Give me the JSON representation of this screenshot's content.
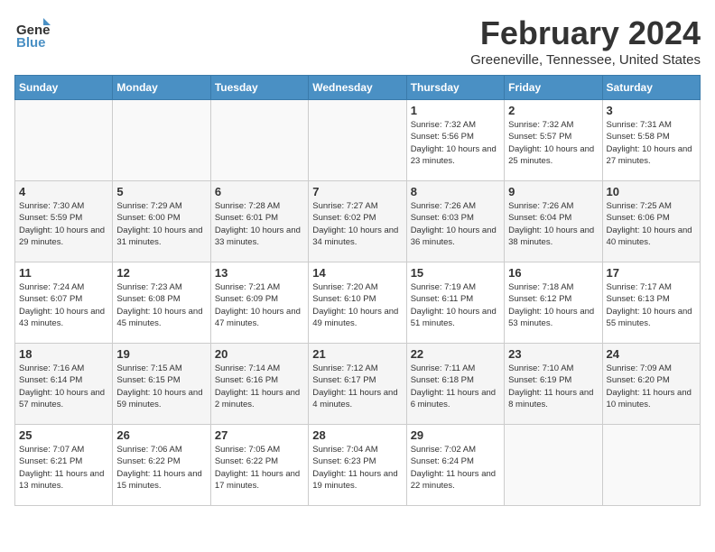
{
  "header": {
    "logo_line1": "General",
    "logo_line2": "Blue",
    "title": "February 2024",
    "subtitle": "Greeneville, Tennessee, United States"
  },
  "weekdays": [
    "Sunday",
    "Monday",
    "Tuesday",
    "Wednesday",
    "Thursday",
    "Friday",
    "Saturday"
  ],
  "weeks": [
    [
      {
        "day": "",
        "empty": true
      },
      {
        "day": "",
        "empty": true
      },
      {
        "day": "",
        "empty": true
      },
      {
        "day": "",
        "empty": true
      },
      {
        "day": "1",
        "sunrise": "Sunrise: 7:32 AM",
        "sunset": "Sunset: 5:56 PM",
        "daylight": "Daylight: 10 hours and 23 minutes."
      },
      {
        "day": "2",
        "sunrise": "Sunrise: 7:32 AM",
        "sunset": "Sunset: 5:57 PM",
        "daylight": "Daylight: 10 hours and 25 minutes."
      },
      {
        "day": "3",
        "sunrise": "Sunrise: 7:31 AM",
        "sunset": "Sunset: 5:58 PM",
        "daylight": "Daylight: 10 hours and 27 minutes."
      }
    ],
    [
      {
        "day": "4",
        "sunrise": "Sunrise: 7:30 AM",
        "sunset": "Sunset: 5:59 PM",
        "daylight": "Daylight: 10 hours and 29 minutes."
      },
      {
        "day": "5",
        "sunrise": "Sunrise: 7:29 AM",
        "sunset": "Sunset: 6:00 PM",
        "daylight": "Daylight: 10 hours and 31 minutes."
      },
      {
        "day": "6",
        "sunrise": "Sunrise: 7:28 AM",
        "sunset": "Sunset: 6:01 PM",
        "daylight": "Daylight: 10 hours and 33 minutes."
      },
      {
        "day": "7",
        "sunrise": "Sunrise: 7:27 AM",
        "sunset": "Sunset: 6:02 PM",
        "daylight": "Daylight: 10 hours and 34 minutes."
      },
      {
        "day": "8",
        "sunrise": "Sunrise: 7:26 AM",
        "sunset": "Sunset: 6:03 PM",
        "daylight": "Daylight: 10 hours and 36 minutes."
      },
      {
        "day": "9",
        "sunrise": "Sunrise: 7:26 AM",
        "sunset": "Sunset: 6:04 PM",
        "daylight": "Daylight: 10 hours and 38 minutes."
      },
      {
        "day": "10",
        "sunrise": "Sunrise: 7:25 AM",
        "sunset": "Sunset: 6:06 PM",
        "daylight": "Daylight: 10 hours and 40 minutes."
      }
    ],
    [
      {
        "day": "11",
        "sunrise": "Sunrise: 7:24 AM",
        "sunset": "Sunset: 6:07 PM",
        "daylight": "Daylight: 10 hours and 43 minutes."
      },
      {
        "day": "12",
        "sunrise": "Sunrise: 7:23 AM",
        "sunset": "Sunset: 6:08 PM",
        "daylight": "Daylight: 10 hours and 45 minutes."
      },
      {
        "day": "13",
        "sunrise": "Sunrise: 7:21 AM",
        "sunset": "Sunset: 6:09 PM",
        "daylight": "Daylight: 10 hours and 47 minutes."
      },
      {
        "day": "14",
        "sunrise": "Sunrise: 7:20 AM",
        "sunset": "Sunset: 6:10 PM",
        "daylight": "Daylight: 10 hours and 49 minutes."
      },
      {
        "day": "15",
        "sunrise": "Sunrise: 7:19 AM",
        "sunset": "Sunset: 6:11 PM",
        "daylight": "Daylight: 10 hours and 51 minutes."
      },
      {
        "day": "16",
        "sunrise": "Sunrise: 7:18 AM",
        "sunset": "Sunset: 6:12 PM",
        "daylight": "Daylight: 10 hours and 53 minutes."
      },
      {
        "day": "17",
        "sunrise": "Sunrise: 7:17 AM",
        "sunset": "Sunset: 6:13 PM",
        "daylight": "Daylight: 10 hours and 55 minutes."
      }
    ],
    [
      {
        "day": "18",
        "sunrise": "Sunrise: 7:16 AM",
        "sunset": "Sunset: 6:14 PM",
        "daylight": "Daylight: 10 hours and 57 minutes."
      },
      {
        "day": "19",
        "sunrise": "Sunrise: 7:15 AM",
        "sunset": "Sunset: 6:15 PM",
        "daylight": "Daylight: 10 hours and 59 minutes."
      },
      {
        "day": "20",
        "sunrise": "Sunrise: 7:14 AM",
        "sunset": "Sunset: 6:16 PM",
        "daylight": "Daylight: 11 hours and 2 minutes."
      },
      {
        "day": "21",
        "sunrise": "Sunrise: 7:12 AM",
        "sunset": "Sunset: 6:17 PM",
        "daylight": "Daylight: 11 hours and 4 minutes."
      },
      {
        "day": "22",
        "sunrise": "Sunrise: 7:11 AM",
        "sunset": "Sunset: 6:18 PM",
        "daylight": "Daylight: 11 hours and 6 minutes."
      },
      {
        "day": "23",
        "sunrise": "Sunrise: 7:10 AM",
        "sunset": "Sunset: 6:19 PM",
        "daylight": "Daylight: 11 hours and 8 minutes."
      },
      {
        "day": "24",
        "sunrise": "Sunrise: 7:09 AM",
        "sunset": "Sunset: 6:20 PM",
        "daylight": "Daylight: 11 hours and 10 minutes."
      }
    ],
    [
      {
        "day": "25",
        "sunrise": "Sunrise: 7:07 AM",
        "sunset": "Sunset: 6:21 PM",
        "daylight": "Daylight: 11 hours and 13 minutes."
      },
      {
        "day": "26",
        "sunrise": "Sunrise: 7:06 AM",
        "sunset": "Sunset: 6:22 PM",
        "daylight": "Daylight: 11 hours and 15 minutes."
      },
      {
        "day": "27",
        "sunrise": "Sunrise: 7:05 AM",
        "sunset": "Sunset: 6:22 PM",
        "daylight": "Daylight: 11 hours and 17 minutes."
      },
      {
        "day": "28",
        "sunrise": "Sunrise: 7:04 AM",
        "sunset": "Sunset: 6:23 PM",
        "daylight": "Daylight: 11 hours and 19 minutes."
      },
      {
        "day": "29",
        "sunrise": "Sunrise: 7:02 AM",
        "sunset": "Sunset: 6:24 PM",
        "daylight": "Daylight: 11 hours and 22 minutes."
      },
      {
        "day": "",
        "empty": true
      },
      {
        "day": "",
        "empty": true
      }
    ]
  ]
}
